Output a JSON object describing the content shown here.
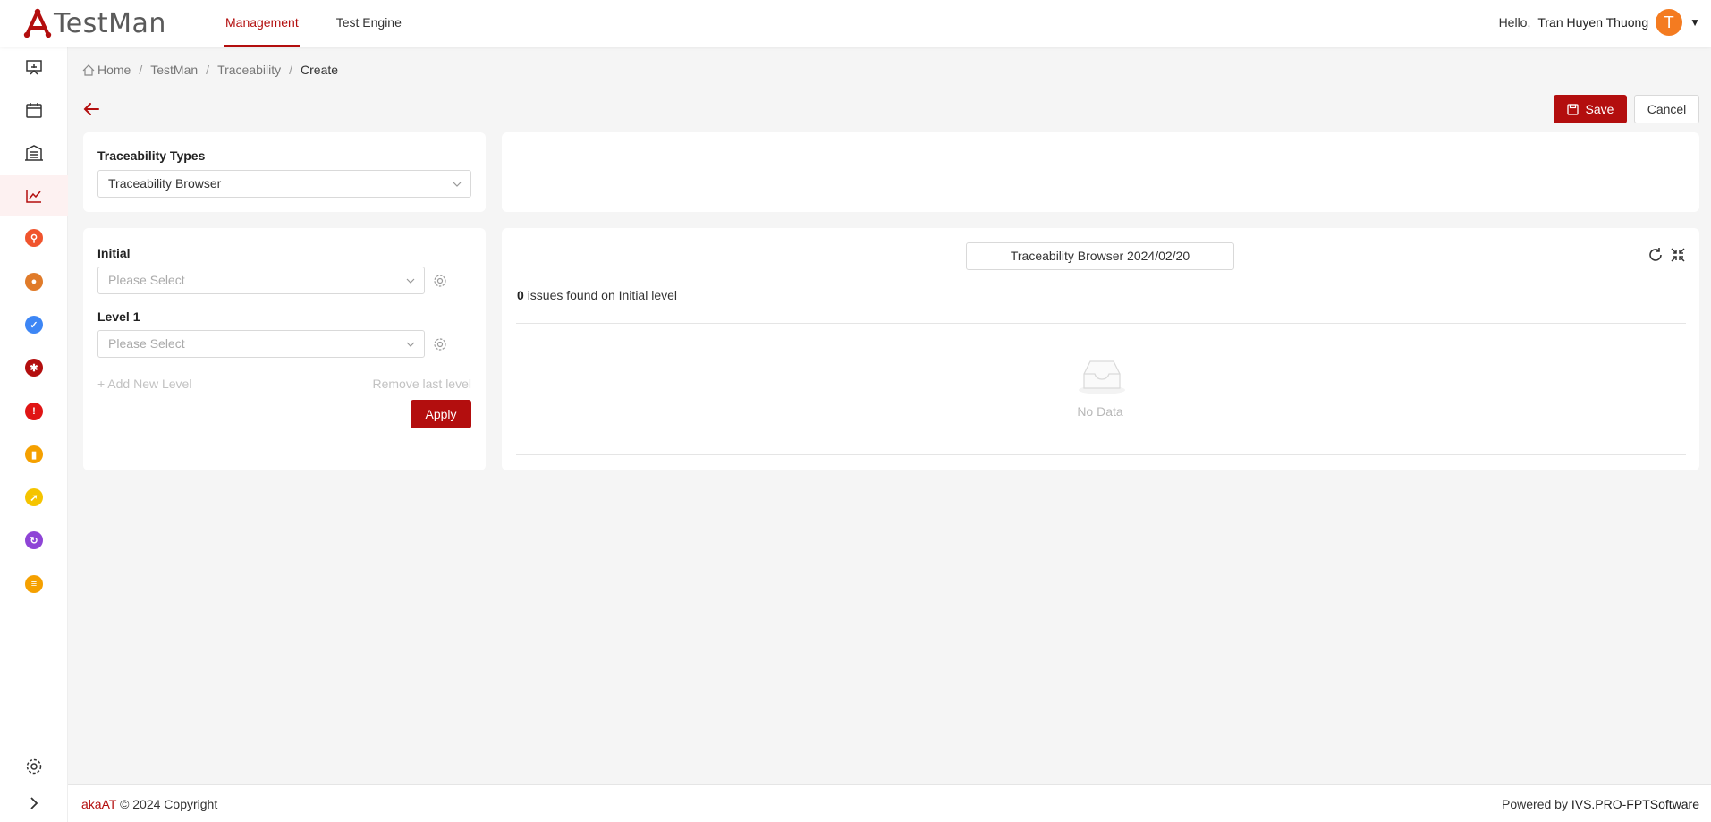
{
  "header": {
    "logo_text": "TestMan",
    "nav": [
      {
        "label": "Management",
        "active": true
      },
      {
        "label": "Test Engine",
        "active": false
      }
    ],
    "greeting": "Hello,",
    "user_name": "Tran Huyen Thuong",
    "avatar_initial": "T",
    "avatar_color": "#f47b20"
  },
  "sidebar": {
    "items": [
      {
        "icon": "presentation-icon"
      },
      {
        "icon": "calendar-icon"
      },
      {
        "icon": "library-icon"
      },
      {
        "icon": "chart-line-icon",
        "active": true
      },
      {
        "icon": "requirement-icon",
        "color": "#f0542d"
      },
      {
        "icon": "bulb-icon",
        "color": "#e07b2a"
      },
      {
        "icon": "check-circle-icon",
        "color": "#3d86f5"
      },
      {
        "icon": "bug-icon",
        "color": "#b30e0e"
      },
      {
        "icon": "alert-icon",
        "color": "#e01515"
      },
      {
        "icon": "pages-icon",
        "color": "#f5a000"
      },
      {
        "icon": "rocket-icon",
        "color": "#f5c400"
      },
      {
        "icon": "cycle-icon",
        "color": "#8e44d6"
      },
      {
        "icon": "report-icon",
        "color": "#f5a000"
      }
    ],
    "bottom": [
      {
        "icon": "settings-icon"
      },
      {
        "icon": "expand-icon"
      }
    ]
  },
  "breadcrumb": {
    "items": [
      "Home",
      "TestMan",
      "Traceability"
    ],
    "current": "Create"
  },
  "toolbar": {
    "save_label": "Save",
    "cancel_label": "Cancel"
  },
  "types_panel": {
    "label": "Traceability Types",
    "value": "Traceability Browser"
  },
  "levels_panel": {
    "initial_label": "Initial",
    "initial_placeholder": "Please Select",
    "level1_label": "Level 1",
    "level1_placeholder": "Please Select",
    "add_level": "+ Add New Level",
    "remove_level": "Remove last level",
    "apply_label": "Apply"
  },
  "result_panel": {
    "title": "Traceability Browser 2024/02/20",
    "issue_count": "0",
    "issues_text": "issues found on Initial level",
    "empty_text": "No Data"
  },
  "footer": {
    "brand": "akaAT",
    "copyright": "© 2024 Copyright",
    "powered_prefix": "Powered by",
    "company": "IVS.PRO-FPTSoftware"
  },
  "colors": {
    "primary": "#b30e0e",
    "background": "#f5f5f5"
  }
}
